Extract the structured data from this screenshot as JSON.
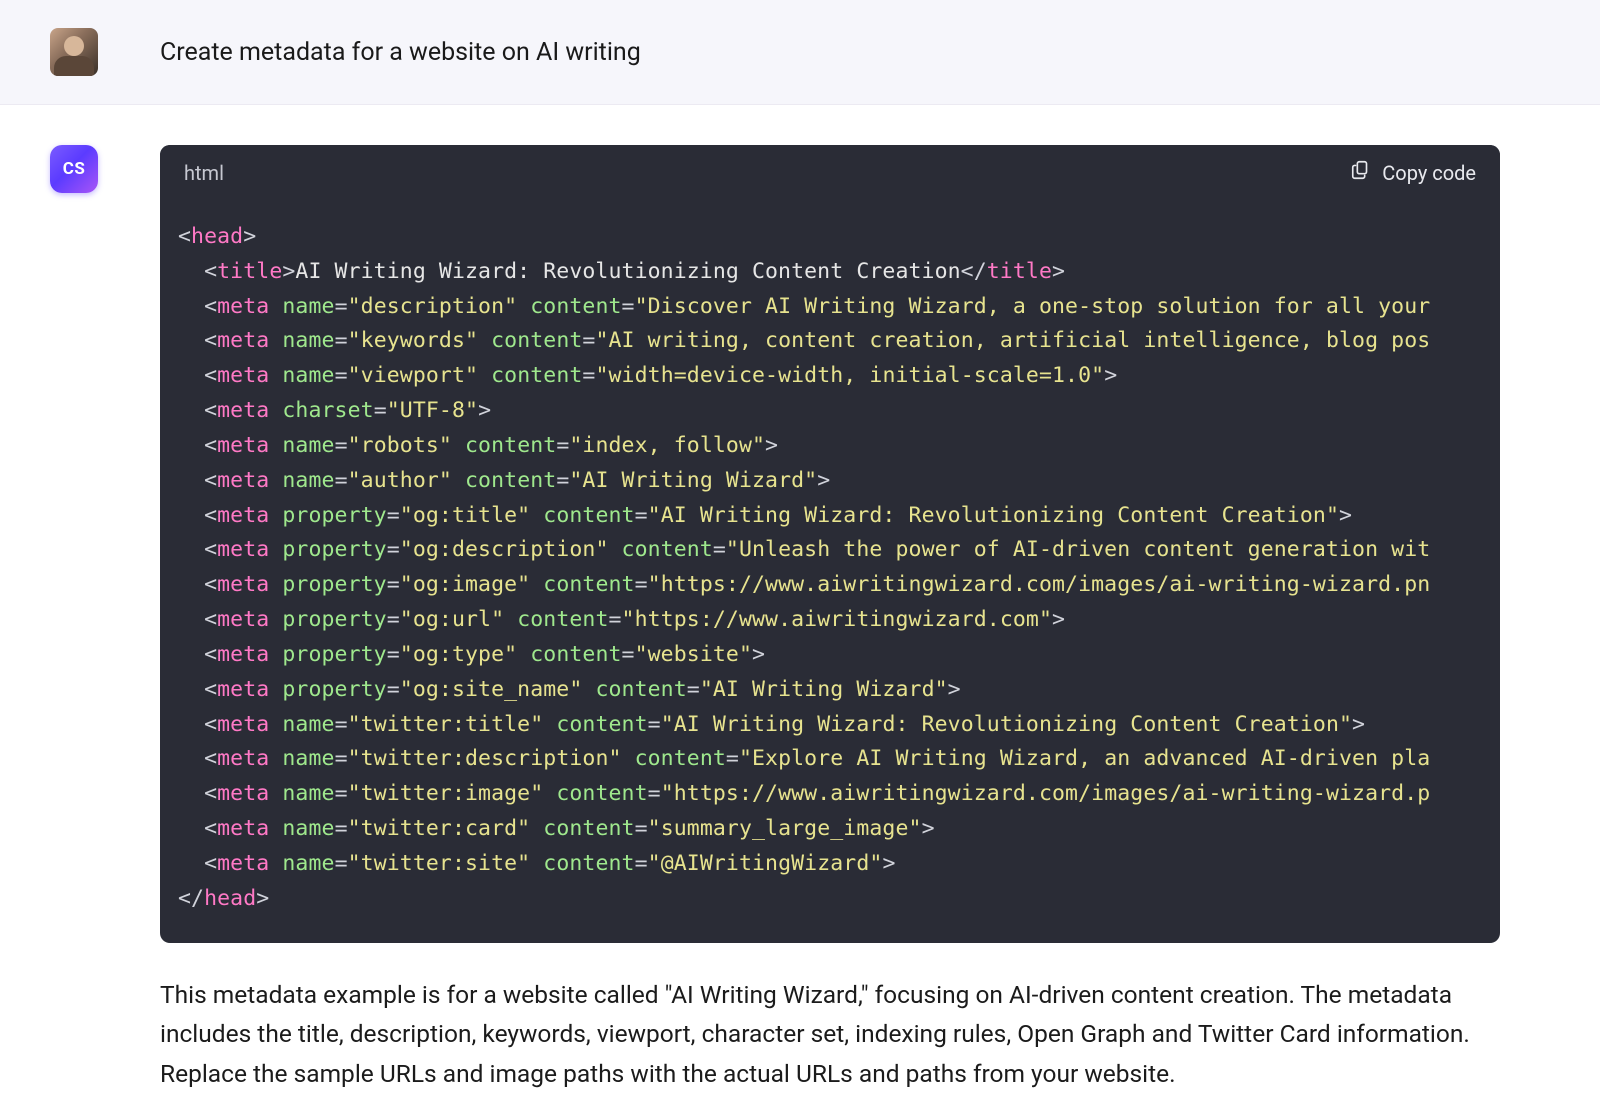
{
  "user": {
    "prompt": "Create metadata for a website on AI writing"
  },
  "assistant": {
    "avatar_label": "CS",
    "code_lang": "html",
    "copy_label": "Copy code",
    "code": {
      "title": "AI Writing Wizard: Revolutionizing Content Creation",
      "meta_description": "Discover AI Writing Wizard, a one-stop solution for all your",
      "meta_keywords": "AI writing, content creation, artificial intelligence, blog pos",
      "meta_viewport": "width=device-width, initial-scale=1.0",
      "meta_charset": "UTF-8",
      "meta_robots": "index, follow",
      "meta_author": "AI Writing Wizard",
      "og_title": "AI Writing Wizard: Revolutionizing Content Creation",
      "og_description": "Unleash the power of AI-driven content generation wit",
      "og_image": "https://www.aiwritingwizard.com/images/ai-writing-wizard.pn",
      "og_url": "https://www.aiwritingwizard.com",
      "og_type": "website",
      "og_site_name": "AI Writing Wizard",
      "tw_title": "AI Writing Wizard: Revolutionizing Content Creation",
      "tw_description": "Explore AI Writing Wizard, an advanced AI-driven pla",
      "tw_image": "https://www.aiwritingwizard.com/images/ai-writing-wizard.p",
      "tw_card": "summary_large_image",
      "tw_site": "@AIWritingWizard"
    },
    "explanation": "This metadata example is for a website called \"AI Writing Wizard,\" focusing on AI-driven content creation. The metadata includes the title, description, keywords, viewport, character set, indexing rules, Open Graph and Twitter Card information. Replace the sample URLs and image paths with the actual URLs and paths from your website."
  }
}
